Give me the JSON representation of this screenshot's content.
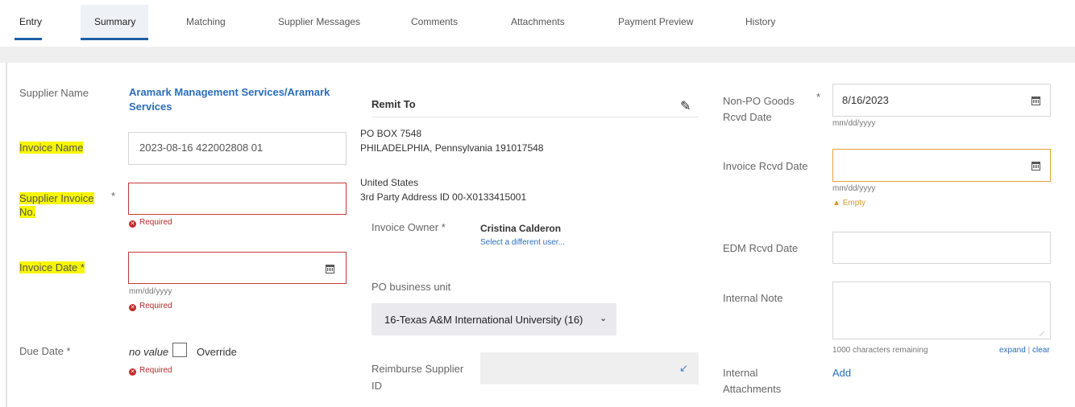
{
  "tabs": [
    "Entry",
    "Summary",
    "Matching",
    "Supplier Messages",
    "Comments",
    "Attachments",
    "Payment Preview",
    "History"
  ],
  "form": {
    "supplier_name_label": "Supplier Name",
    "supplier_name_value_line1": "Aramark Management Services/Aramark",
    "supplier_name_value_line2": "Services",
    "invoice_name_label": "Invoice Name",
    "invoice_name_value": "2023-08-16 422002808 01",
    "supplier_invoice_label_line1": "Supplier Invoice",
    "supplier_invoice_label_line2": "No.",
    "required": "Required",
    "invoice_date_label": "Invoice Date",
    "date_format": "mm/dd/yyyy",
    "due_date_label": "Due Date",
    "due_date_value": "no value",
    "override_label": "Override",
    "star": "*"
  },
  "remit": {
    "title": "Remit To",
    "line1": "PO BOX 7548",
    "line2": "PHILADELPHIA, Pennsylvania 191017548",
    "country": "United States",
    "address_id": "3rd Party Address ID 00-X0133415001",
    "owner_label": "Invoice Owner",
    "owner_name": "Cristina Calderon",
    "owner_link": "Select a different user...",
    "po_bu_label": "PO business unit",
    "po_bu_value": "16-Texas A&M International University (16)",
    "reimburse_label_line1": "Reimburse Supplier",
    "reimburse_label_line2": "ID"
  },
  "right": {
    "nonpo_label_line1": "Non-PO Goods",
    "nonpo_label_line2": "Rcvd Date",
    "nonpo_value": "8/16/2023",
    "date_format": "mm/dd/yyyy",
    "inv_rcvd_label": "Invoice Rcvd Date",
    "empty": "Empty",
    "edm_label": "EDM Rcvd Date",
    "internal_note_label": "Internal Note",
    "chars_remaining": "1000 characters remaining",
    "expand": "expand",
    "clear": "clear",
    "internal_attach_line1": "Internal",
    "internal_attach_line2": "Attachments",
    "add": "Add"
  },
  "colors": {
    "accent": "#1f5fa6",
    "link": "#2a6ebb",
    "error": "#c23a3a",
    "warn": "#e6a03c",
    "highlight": "#f6f600"
  }
}
